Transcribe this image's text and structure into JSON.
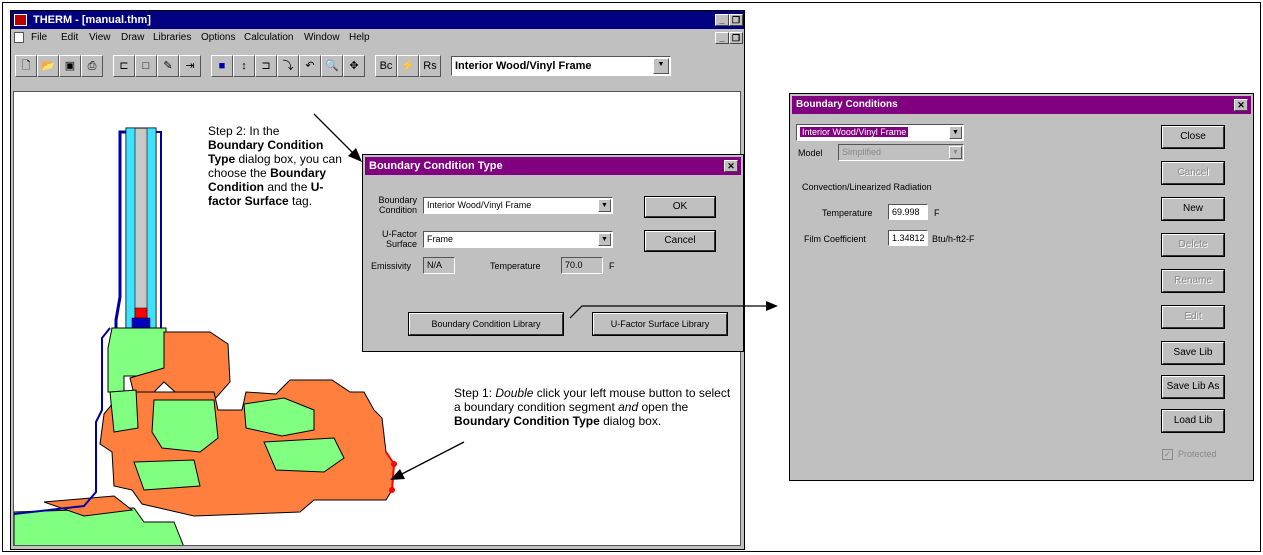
{
  "therm_window": {
    "title": "THERM - [manual.thm]",
    "title_color": "#000080",
    "menu": [
      "File",
      "Edit",
      "View",
      "Draw",
      "Libraries",
      "Options",
      "Calculation",
      "Window",
      "Help"
    ],
    "boundary_dropdown_value": "Interior Wood/Vinyl Frame"
  },
  "bc_type_dialog": {
    "title": "Boundary Condition Type",
    "title_color": "#800080",
    "boundary_condition_label": "Boundary Condition",
    "boundary_condition_value": "Interior Wood/Vinyl Frame",
    "ufactor_surface_label": "U-Factor Surface",
    "ufactor_surface_value": "Frame",
    "emissivity_label": "Emissivity",
    "emissivity_value": "N/A",
    "temperature_label": "Temperature",
    "temperature_value": "70.0",
    "temperature_unit": "F",
    "ok_label": "OK",
    "cancel_label": "Cancel",
    "bc_library_label": "Boundary Condition Library",
    "ufactor_library_label": "U-Factor Surface Library"
  },
  "bc_dialog": {
    "title": "Boundary Conditions",
    "title_color": "#800080",
    "selected_condition": "Interior Wood/Vinyl Frame",
    "model_label": "Model",
    "model_value": "Simplified",
    "section_label": "Convection/Linearized Radiation",
    "temperature_label": "Temperature",
    "temperature_value": "69.998",
    "temperature_unit": "F",
    "film_label": "Film Coefficient",
    "film_value": "1.34812",
    "film_unit": "Btu/h-ft2-F",
    "buttons": [
      "Close",
      "Cancel",
      "New",
      "Delete",
      "Rename",
      "Edit",
      "Save Lib",
      "Save Lib As",
      "Load Lib"
    ],
    "protected_label": "Protected"
  },
  "annotations": {
    "step2_line1": "Step 2:  In the",
    "step2_b1": "Boundary Condition Type",
    "step2_mid": "dialog box, you can choose the",
    "step2_b2": "Boundary Condition",
    "step2_and": "and the",
    "step2_b3": "U-factor Surface",
    "step2_end": "tag.",
    "step1_a": "Step 1:",
    "step1_double": "Double",
    "step1_b": "click your left mouse button to select a boundary condition segment",
    "step1_and": "and",
    "step1_c": "open the",
    "step1_bold": "Boundary Condition Type",
    "step1_end": "dialog box."
  },
  "colors": {
    "frame_orange": "#ff7f3f",
    "frame_green": "#80ff80",
    "glass_cyan": "#40e0ff",
    "blue_edge": "#0000a0",
    "red_spacer": "#ff0000"
  }
}
